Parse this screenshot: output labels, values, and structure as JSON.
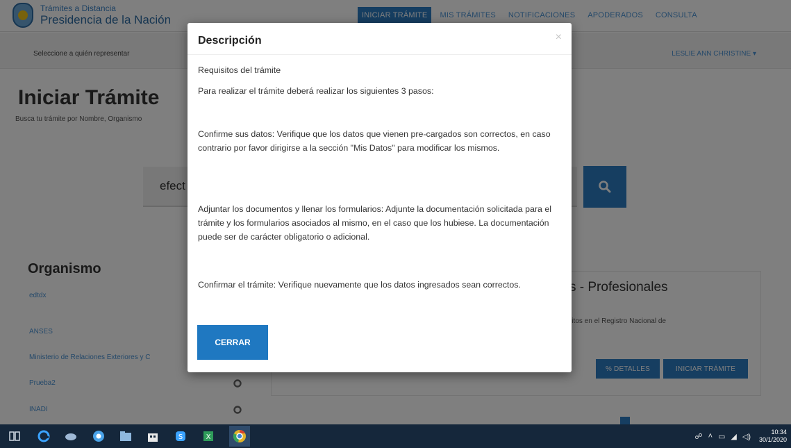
{
  "header": {
    "logo_line1": "Trámites a Distancia",
    "logo_line2": "Presidencia de la Nación",
    "nav": [
      {
        "label": "INICIAR TRÁMITE",
        "active": true
      },
      {
        "label": "MIS TRÁMITES",
        "active": false
      },
      {
        "label": "NOTIFICACIONES",
        "active": false
      },
      {
        "label": "APODERADOS",
        "active": false
      },
      {
        "label": "CONSULTA",
        "active": false
      }
    ]
  },
  "subheader": {
    "represent_label": "Seleccione a quién representar",
    "user_menu": "LESLIE ANN CHRISTINE ▾"
  },
  "main": {
    "title": "Iniciar Trámite",
    "subtitle": "Busca tu trámite por Nombre, Organismo",
    "search_value": "efect",
    "search_icon": "magnifier-icon"
  },
  "organismo": {
    "title": "Organismo",
    "items": [
      "edtdx",
      "ANSES",
      "Ministerio de Relaciones Exteriores y C",
      "Prueba2",
      "INADI"
    ]
  },
  "result_card": {
    "title": "s - Profesionales",
    "description": "ritos en el Registro Nacional de",
    "details_button": "% DETALLES",
    "start_button": "INICIAR TRÁMITE"
  },
  "modal": {
    "title": "Descripción",
    "close_glyph": "×",
    "requirements_heading": "Requisitos del trámite",
    "intro": "Para realizar el trámite deberá realizar los siguientes 3 pasos:",
    "step1": "Confirme sus datos: Verifique que los datos que vienen pre-cargados son correctos, en caso contrario por favor dirigirse a la sección \"Mis Datos\" para modificar los mismos.",
    "step2": "Adjuntar los documentos y llenar los formularios: Adjunte la documentación solicitada para el trámite y los formularios asociados al mismo, en el caso que los hubiese. La documentación puede ser de carácter obligatorio o adicional.",
    "step3": "Confirmar el trámite: Verifique nuevamente que los datos ingresados sean correctos.",
    "close_button": "CERRAR"
  },
  "taskbar": {
    "time": "10:34",
    "date": "30/1/2020",
    "icons": [
      "taskview-icon",
      "edge-icon",
      "paint-icon",
      "chrome-app-icon",
      "file-explorer-icon",
      "store-icon",
      "skype-icon",
      "excel-icon",
      "chrome-icon"
    ]
  },
  "colors": {
    "accent": "#2d7cc2",
    "button": "#1f78c1",
    "taskbar": "#15273b"
  }
}
